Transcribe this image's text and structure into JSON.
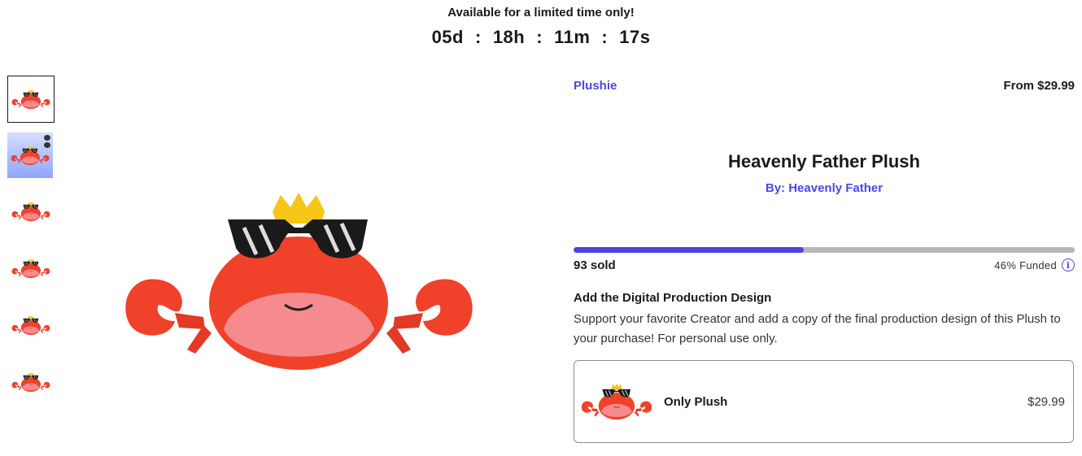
{
  "banner": {
    "title": "Available for a limited time only!",
    "days": "05d",
    "hours": "18h",
    "minutes": "11m",
    "seconds": "17s",
    "separator": ":"
  },
  "product": {
    "category": "Plushie",
    "price_from": "From $29.99",
    "title": "Heavenly Father Plush",
    "creator": "By: Heavenly Father"
  },
  "funding": {
    "sold": "93 sold",
    "funded_label": "46% Funded",
    "progress_fraction": 0.46,
    "info_glyph": "i"
  },
  "digital": {
    "title": "Add the Digital Production Design",
    "description": "Support your favorite Creator and add a copy of the final production design of this Plush to your purchase! For personal use only."
  },
  "option": {
    "label": "Only Plush",
    "price": "$29.99"
  },
  "colors": {
    "accent": "#4a47e8",
    "progress_fill": "#4b45e0",
    "progress_track": "#b8b8b8",
    "crab_red": "#f0412a"
  },
  "icons": [
    "info-icon"
  ]
}
